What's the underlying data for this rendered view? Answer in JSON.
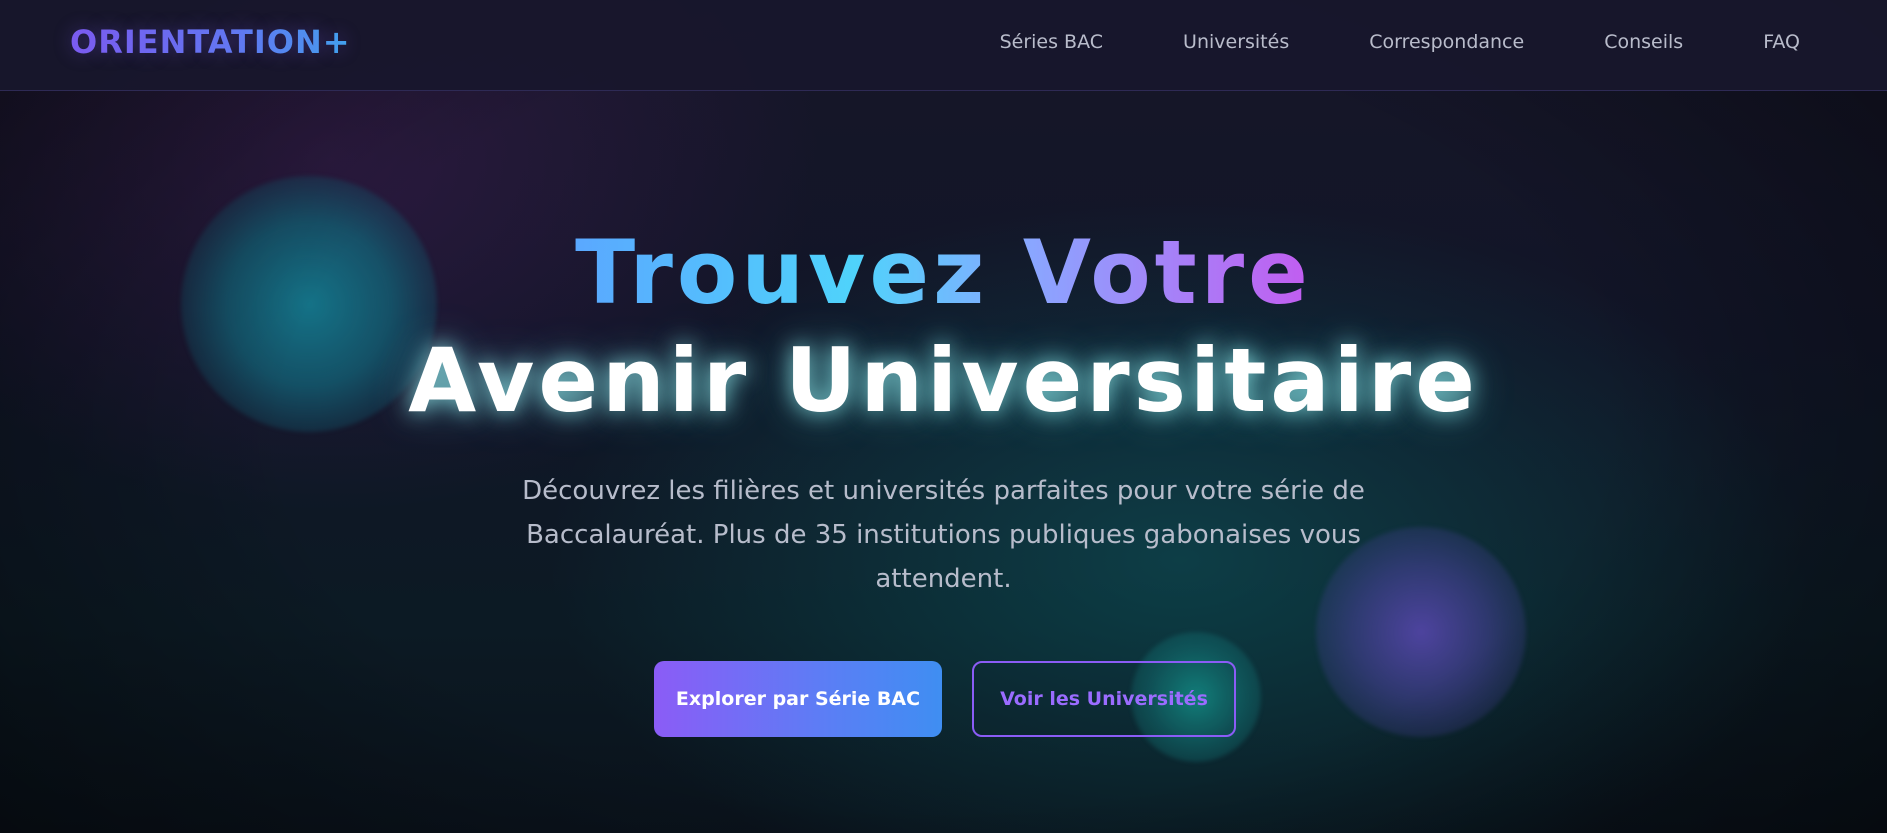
{
  "nav": {
    "logo": "ORIENTATION+",
    "links": [
      {
        "label": "Séries BAC"
      },
      {
        "label": "Universités"
      },
      {
        "label": "Correspondance"
      },
      {
        "label": "Conseils"
      },
      {
        "label": "FAQ"
      }
    ]
  },
  "hero": {
    "title_line1": "Trouvez Votre",
    "title_line2": "Avenir Universitaire",
    "subtitle": "Découvrez les filières et universités parfaites pour votre série de Baccalauréat. Plus de 35 institutions publiques gabonaises vous attendent.",
    "primary_button": "Explorer par Série BAC",
    "secondary_button": "Voir les Universités"
  },
  "colors": {
    "accent_violet": "#8b5cf6",
    "accent_blue": "#3f8ef2",
    "accent_cyan": "#4fd3fb",
    "background": "#111527"
  }
}
